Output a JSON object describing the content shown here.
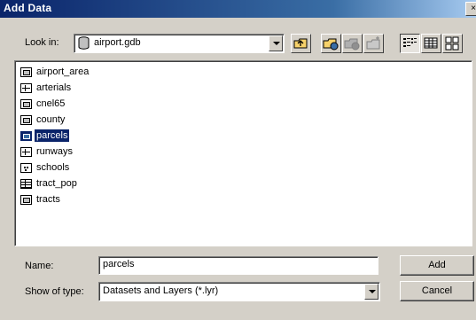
{
  "window": {
    "title": "Add Data",
    "close_glyph": "×"
  },
  "look_in": {
    "label": "Look in:",
    "value": "airport.gdb",
    "icon": "database-icon"
  },
  "toolbar": {
    "buttons": [
      {
        "name": "up-one-level-button",
        "icon": "folder-up-icon"
      },
      {
        "name": "connect-folder-button",
        "icon": "connect-folder-icon"
      },
      {
        "name": "disconnect-folder-button",
        "icon": "disconnect-folder-icon"
      },
      {
        "name": "new-folder-button",
        "icon": "new-folder-icon"
      },
      {
        "name": "list-view-button",
        "icon": "list-view-icon",
        "pressed": true
      },
      {
        "name": "details-view-button",
        "icon": "details-view-icon"
      },
      {
        "name": "thumbnails-view-button",
        "icon": "thumbnails-view-icon"
      }
    ]
  },
  "items": [
    {
      "label": "airport_area",
      "type": "polygon"
    },
    {
      "label": "arterials",
      "type": "line"
    },
    {
      "label": "cnel65",
      "type": "polygon"
    },
    {
      "label": "county",
      "type": "polygon"
    },
    {
      "label": "parcels",
      "type": "polygon",
      "selected": true
    },
    {
      "label": "runways",
      "type": "line"
    },
    {
      "label": "schools",
      "type": "point"
    },
    {
      "label": "tract_pop",
      "type": "table"
    },
    {
      "label": "tracts",
      "type": "polygon"
    }
  ],
  "name_field": {
    "label": "Name:",
    "value": "parcels"
  },
  "type_field": {
    "label": "Show of type:",
    "value": "Datasets and Layers (*.lyr)"
  },
  "buttons": {
    "add": "Add",
    "cancel": "Cancel"
  },
  "colors": {
    "title_gradient_start": "#0a246a",
    "selection": "#0a246a",
    "face": "#d4d0c8"
  }
}
